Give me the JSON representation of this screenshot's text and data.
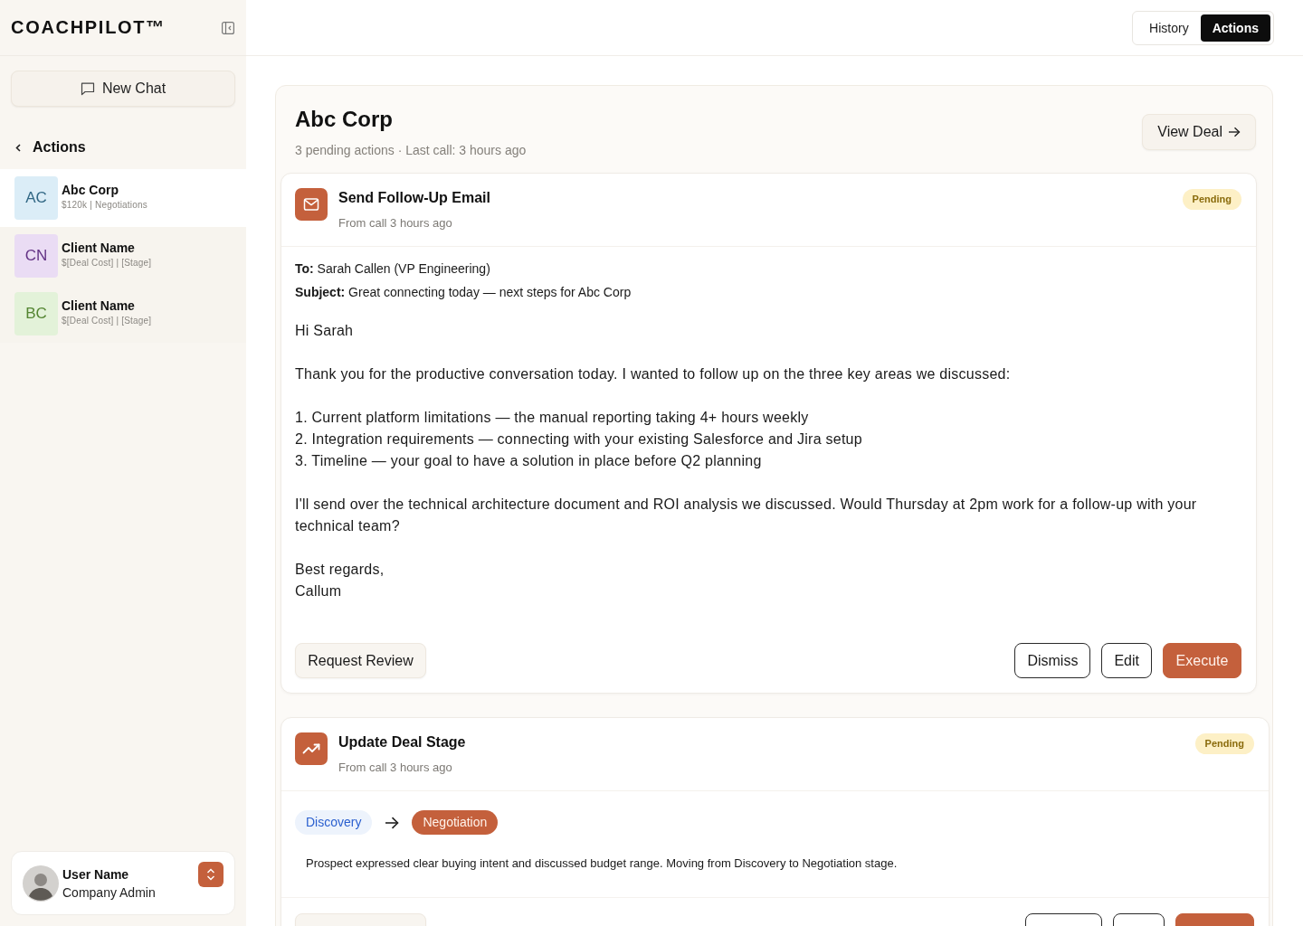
{
  "sidebar": {
    "logo": "COACHPILOT™",
    "new_chat": "New Chat",
    "section": "Actions",
    "deals": [
      {
        "initials": "AC",
        "name": "Abc Corp",
        "meta": "$120k | Negotiations",
        "color": "#dbedf7",
        "selected": true
      },
      {
        "initials": "CN",
        "name": "Client Name",
        "meta": "$[Deal Cost] | [Stage]",
        "color": "#eadcf4",
        "selected": false
      },
      {
        "initials": "BC",
        "name": "Client Name",
        "meta": "$[Deal Cost] | [Stage]",
        "color": "#e3f2d9",
        "selected": false
      }
    ],
    "user": {
      "name": "User Name",
      "role": "Company Admin"
    }
  },
  "header": {
    "tabs": [
      {
        "label": "History",
        "selected": false
      },
      {
        "label": "Actions",
        "selected": true
      }
    ]
  },
  "deal": {
    "title": "Abc Corp",
    "summary": "3 pending actions · Last call: 3 hours ago",
    "view_button": "View Deal",
    "actions": [
      {
        "kind": "email",
        "title": "Send Follow-Up Email",
        "source": "From call 3 hours ago",
        "status": "Pending",
        "to": "**To:** Sarah Callen (VP Engineering)",
        "subject": "**Subject:** Great connecting today — next steps for Abc Corp",
        "paragraphs": [
          {
            "kind": "greeting",
            "text": "Hi Sarah"
          },
          {
            "kind": "text",
            "text": "Thank you for the productive conversation today. I wanted to follow up on the three key areas we discussed:"
          },
          {
            "kind": "list",
            "items": [
              "1. Current platform limitations — the manual reporting taking 4+ hours weekly",
              "2. Integration requirements — connecting with your existing Salesforce and Jira setup",
              "3. Timeline — your goal to have a solution in place before Q2 planning"
            ]
          },
          {
            "kind": "text",
            "text": "I'll send over the technical architecture document and ROI analysis we discussed. Would Thursday at 2pm work for a follow-up with your technical team?"
          },
          {
            "kind": "closing",
            "lines": [
              "Best regards,",
              "Callum"
            ]
          }
        ],
        "buttons": [
          {
            "kind": "review",
            "label": "Request Review"
          },
          {
            "kind": "dismiss",
            "label": "Dismiss"
          },
          {
            "kind": "edit",
            "label": "Edit"
          },
          {
            "kind": "execute",
            "label": "Execute"
          }
        ]
      },
      {
        "kind": "stage_change",
        "title": "Update Deal Stage",
        "source": "From call 3 hours ago",
        "status": "Pending",
        "from_stage": "Discovery",
        "to_stage": "Negotiation",
        "reason": "Prospect expressed clear buying intent and discussed budget range. Moving from Discovery to Negotiation stage.",
        "buttons": [
          {
            "kind": "secondary"
          },
          {
            "kind": "outline"
          },
          {
            "kind": "outline"
          },
          {
            "kind": "primary"
          }
        ]
      }
    ]
  }
}
